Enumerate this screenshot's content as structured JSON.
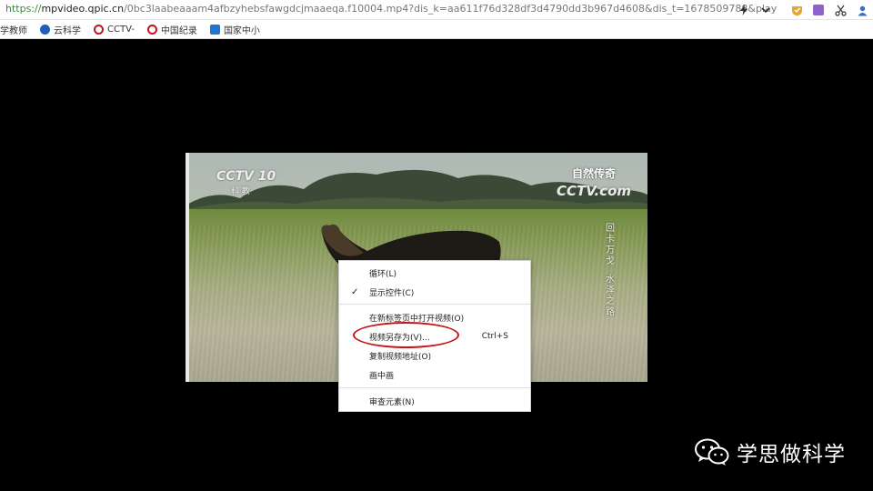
{
  "address_bar": {
    "url_scheme": "https://",
    "url_host": "mpvideo.qpic.cn",
    "url_path": "/0bc3laabeaaam4afbzyhebsfawgdcjmaaeqa.f10004.mp4?dis_k=aa611f76d328df3d4790dd3b967d4608&dis_t=1678509788&play",
    "icons": [
      "lightning-icon",
      "chevron-down-icon",
      "extension-icon",
      "extension-icon",
      "scissors-icon",
      "user-icon"
    ]
  },
  "bookmarks": [
    {
      "label": "学教师",
      "color": "#ffffff"
    },
    {
      "label": "云科学",
      "color": "#1f5fb8"
    },
    {
      "label": "CCTV-",
      "color": "#c1121f"
    },
    {
      "label": "中国纪录",
      "color": "#c1121f"
    },
    {
      "label": "国家中小",
      "color": "#1f75d2"
    }
  ],
  "video": {
    "logo_left_main": "CCTV 10",
    "logo_left_sub": "科 教",
    "logo_right_top": "自然传奇",
    "logo_right_main": "CCTV.com",
    "caption_vertical_1": "回卡万戈",
    "caption_vertical_2": "水泽之路"
  },
  "context_menu": {
    "items": [
      {
        "label": "循环(L)",
        "checked": false,
        "shortcut": ""
      },
      {
        "label": "显示控件(C)",
        "checked": true,
        "shortcut": ""
      },
      {
        "label": "在新标签页中打开视频(O)",
        "checked": false,
        "shortcut": ""
      },
      {
        "label": "视频另存为(V)...",
        "checked": false,
        "shortcut": "Ctrl+S"
      },
      {
        "label": "复制视频地址(O)",
        "checked": false,
        "shortcut": ""
      },
      {
        "label": "画中画",
        "checked": false,
        "shortcut": ""
      },
      {
        "label": "审查元素(N)",
        "checked": false,
        "shortcut": ""
      }
    ],
    "check_glyph": "✓",
    "highlight_color": "#c8141a"
  },
  "watermark": {
    "text": "学思做科学"
  }
}
